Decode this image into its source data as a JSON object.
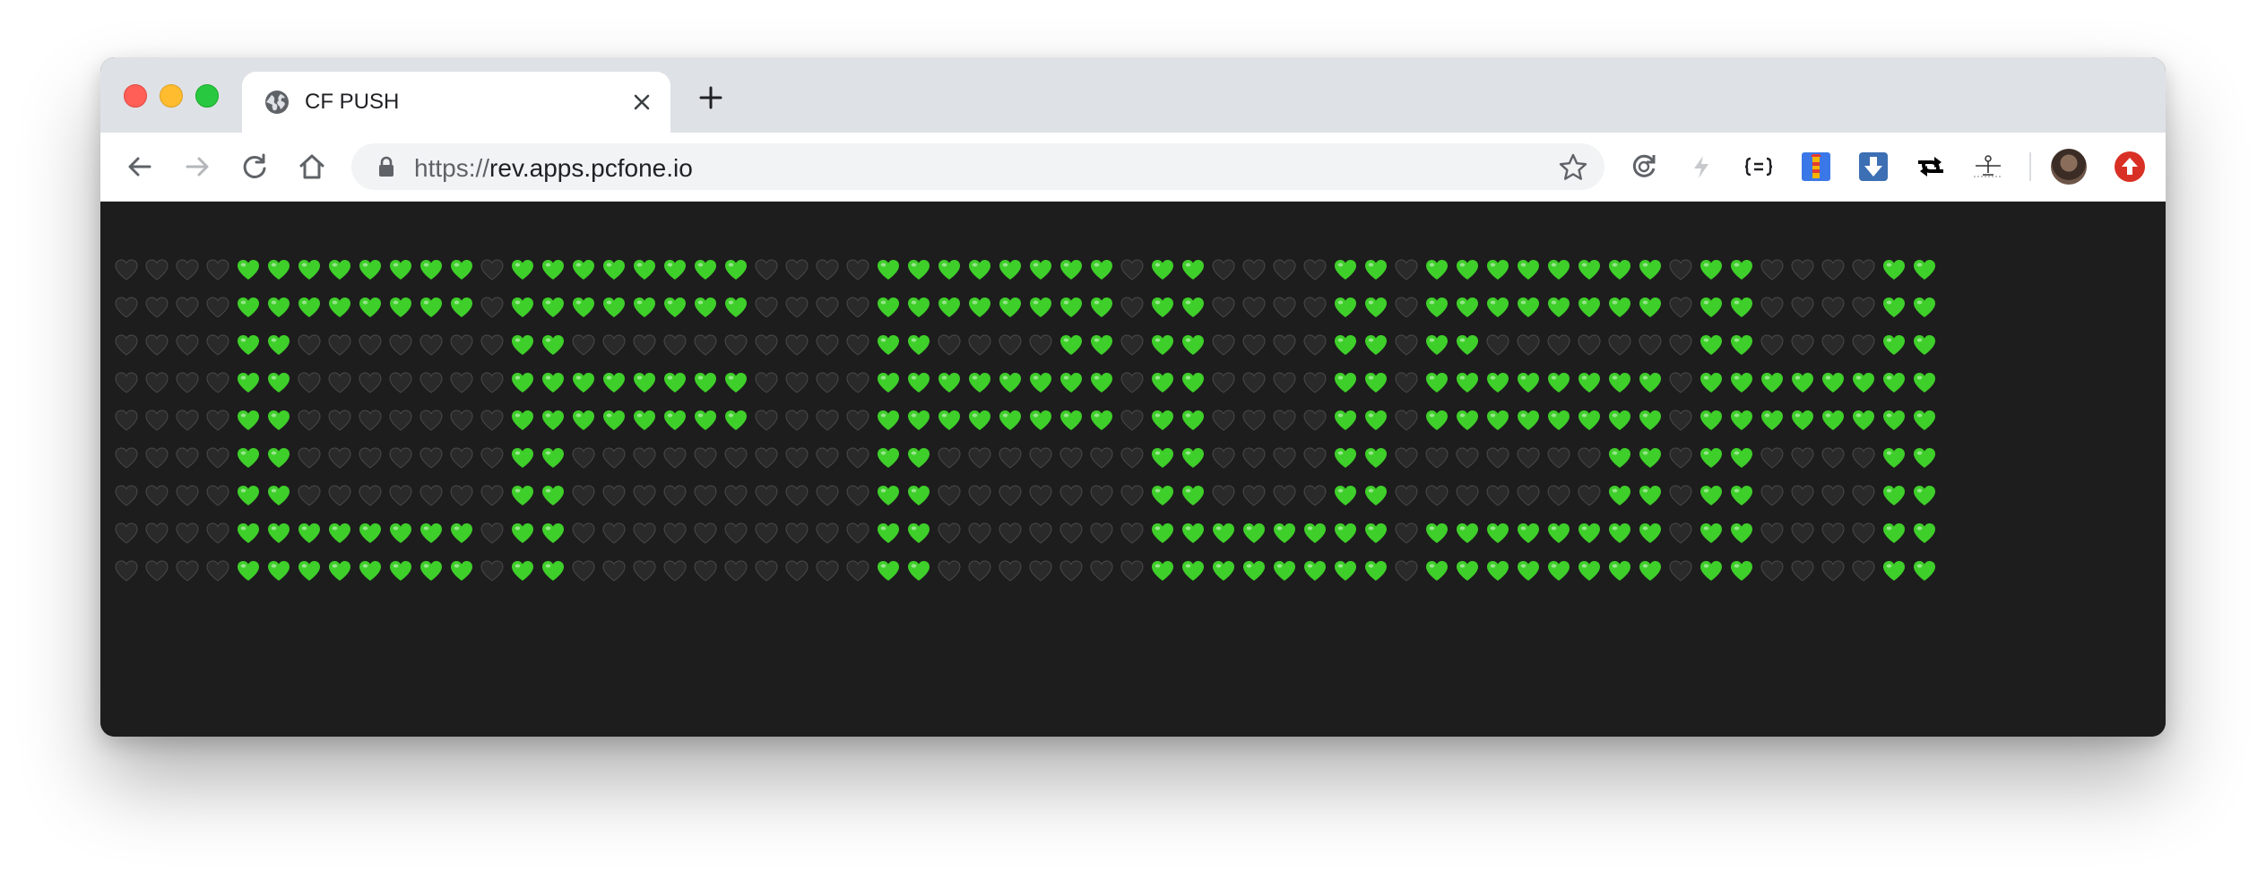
{
  "window": {
    "traffic_lights": [
      "close",
      "minimize",
      "maximize"
    ]
  },
  "tab": {
    "title": "CF PUSH",
    "favicon": "globe-icon",
    "close_icon": "close-icon",
    "new_tab_icon": "plus-icon"
  },
  "toolbar": {
    "back_icon": "back-arrow-icon",
    "forward_icon": "forward-arrow-icon",
    "reload_icon": "reload-icon",
    "home_icon": "home-icon",
    "url_scheme": "https://",
    "url_host": "rev.apps.pcfone.io",
    "bookmark_icon": "star-icon",
    "extensions": [
      "sync-icon",
      "bolt-icon",
      "json-formatter-icon",
      "lighthouse-icon",
      "download-icon",
      "shuffle-icon",
      "scale-icon"
    ],
    "avatar": "avatar",
    "update_icon": "update-icon"
  },
  "colors": {
    "green_heart": "#3fcf2a",
    "black_heart": "#2a2a2a",
    "page_background": "#1d1d1d"
  },
  "heart_grid": {
    "legend": {
      "G": "green-heart",
      "B": "black-heart"
    },
    "rows": [
      "BBBBGGGGGGGGBGGGGGGGGBBBBGGGGGGGGBGGBBBBGGBGGGGGGGGBGGBBBBGG",
      "BBBBGGGGGGGGBGGGGGGGGBBBBGGGGGGGGBGGBBBBGGBGGGGGGGGBGGBBBBGG",
      "BBBBGGBBBBBBBGGBBBBBBBBBBGGBBBBGGBGGBBBBGGBGGBBBBBBBGGBBBBGG",
      "BBBBGGBBBBBBBGGGGGGGGBBBBGGGGGGGGBGGBBBBGGBGGGGGGGGBGGGGGGGG",
      "BBBBGGBBBBBBBGGGGGGGGBBBBGGGGGGGGBGGBBBBGGBGGGGGGGGBGGGGGGGG",
      "BBBBGGBBBBBBBGGBBBBBBBBBBGGBBBBBBBGGBBBBGGBBBBBBBGGBGGBBBBGG",
      "BBBBGGBBBBBBBGGBBBBBBBBBBGGBBBBBBBGGBBBBGGBBBBBBBGGBGGBBBBGG",
      "BBBBGGGGGGGGBGGBBBBBBBBBBGGBBBBBBBGGGGGGGGBGGGGGGGGBGGBBBBGG",
      "BBBBGGGGGGGGBGGBBBBBBBBBBGGBBBBBBBGGGGGGGGBGGGGGGGGBGGBBBBGG"
    ]
  }
}
